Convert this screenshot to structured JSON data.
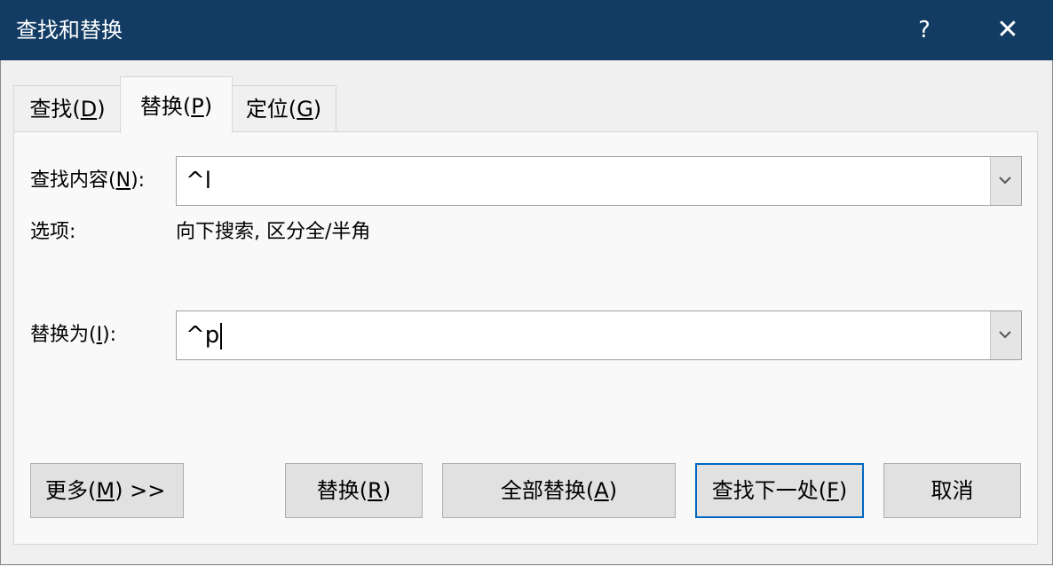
{
  "window": {
    "title": "查找和替换",
    "help_label": "?",
    "close_label": "✕"
  },
  "tabs": [
    {
      "pre": "查找(",
      "key": "D",
      "post": ")",
      "active": false
    },
    {
      "pre": "替换(",
      "key": "P",
      "post": ")",
      "active": true
    },
    {
      "pre": "定位(",
      "key": "G",
      "post": ")",
      "active": false
    }
  ],
  "find": {
    "label_pre": "查找内容(",
    "label_key": "N",
    "label_post": "):",
    "value": "^l"
  },
  "options": {
    "label": "选项:",
    "value": "向下搜索, 区分全/半角"
  },
  "replace": {
    "label_pre": "替换为(",
    "label_key": "I",
    "label_post": "):",
    "value": "^p"
  },
  "buttons": {
    "more": {
      "pre": "更多(",
      "key": "M",
      "post": ") >>"
    },
    "replace": {
      "pre": "替换(",
      "key": "R",
      "post": ")"
    },
    "replace_all": {
      "pre": "全部替换(",
      "key": "A",
      "post": ")"
    },
    "find_next": {
      "pre": "查找下一处(",
      "key": "F",
      "post": ")"
    },
    "cancel": {
      "label": "取消"
    }
  },
  "colors": {
    "titlebar": "#133c64",
    "default_button_border": "#0067c0"
  }
}
